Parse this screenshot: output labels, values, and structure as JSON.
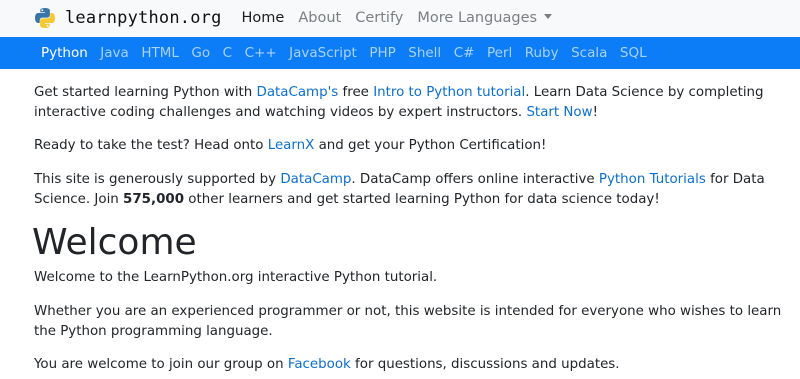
{
  "brand": {
    "logo_icon": "python-logo-icon",
    "name": "learnpython.org"
  },
  "topnav": {
    "home": "Home",
    "about": "About",
    "certify": "Certify",
    "more_languages": "More Languages"
  },
  "languages": [
    "Python",
    "Java",
    "HTML",
    "Go",
    "C",
    "C++",
    "JavaScript",
    "PHP",
    "Shell",
    "C#",
    "Perl",
    "Ruby",
    "Scala",
    "SQL"
  ],
  "active_language": "Python",
  "colors": {
    "topbar_bg": "#f8f9fa",
    "langbar_bg": "#0d7cf7",
    "link": "#0b6fd1"
  },
  "intro": {
    "t1": "Get started learning Python with ",
    "link_datacamp": "DataCamp's",
    "t2": " free ",
    "link_intro": "Intro to Python tutorial",
    "t3": ". Learn Data Science by completing interactive coding challenges and watching videos by expert instructors. ",
    "link_start": "Start Now",
    "t4": "!"
  },
  "test": {
    "t1": "Ready to take the test? Head onto ",
    "link_learnx": "LearnX",
    "t2": " and get your Python Certification!"
  },
  "support": {
    "t1": "This site is generously supported by ",
    "link_datacamp": "DataCamp",
    "t2": ". DataCamp offers online interactive ",
    "link_tutorials": "Python Tutorials",
    "t3": " for Data Science. Join ",
    "count": "575,000",
    "t4": " other learners and get started learning Python for data science today!"
  },
  "welcome": {
    "heading": "Welcome",
    "p1": "Welcome to the LearnPython.org interactive Python tutorial.",
    "p2": "Whether you are an experienced programmer or not, this website is intended for everyone who wishes to learn the Python programming language.",
    "p3_t1": "You are welcome to join our group on ",
    "p3_link": "Facebook",
    "p3_t2": " for questions, discussions and updates."
  }
}
